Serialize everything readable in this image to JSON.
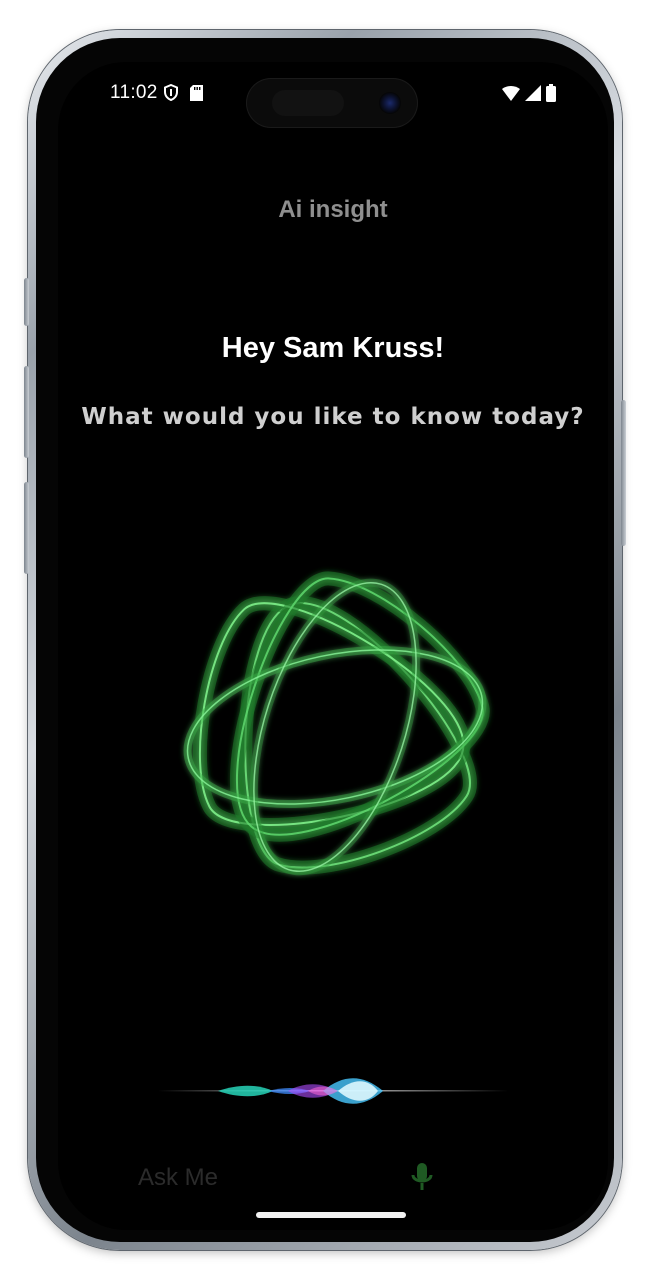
{
  "status_bar": {
    "time": "11:02",
    "left_icons": [
      "shield-icon",
      "sd-card-icon"
    ],
    "right_icons": [
      "wifi-icon",
      "signal-icon",
      "battery-icon"
    ]
  },
  "header": {
    "title": "Ai insight"
  },
  "main": {
    "greeting": "Hey Sam Kruss!",
    "prompt": "What would you like to know today?",
    "orb_icon": "ai-orb-icon",
    "wave_icon": "voice-waveform-icon"
  },
  "input": {
    "placeholder": "Ask Me",
    "value": "",
    "mic_icon": "microphone-icon"
  },
  "colors": {
    "background": "#000000",
    "title": "#8f8f8f",
    "greeting": "#ffffff",
    "prompt": "#cfcfcf",
    "accent_green": "#4cd964",
    "mic_green": "#1f5a23"
  }
}
